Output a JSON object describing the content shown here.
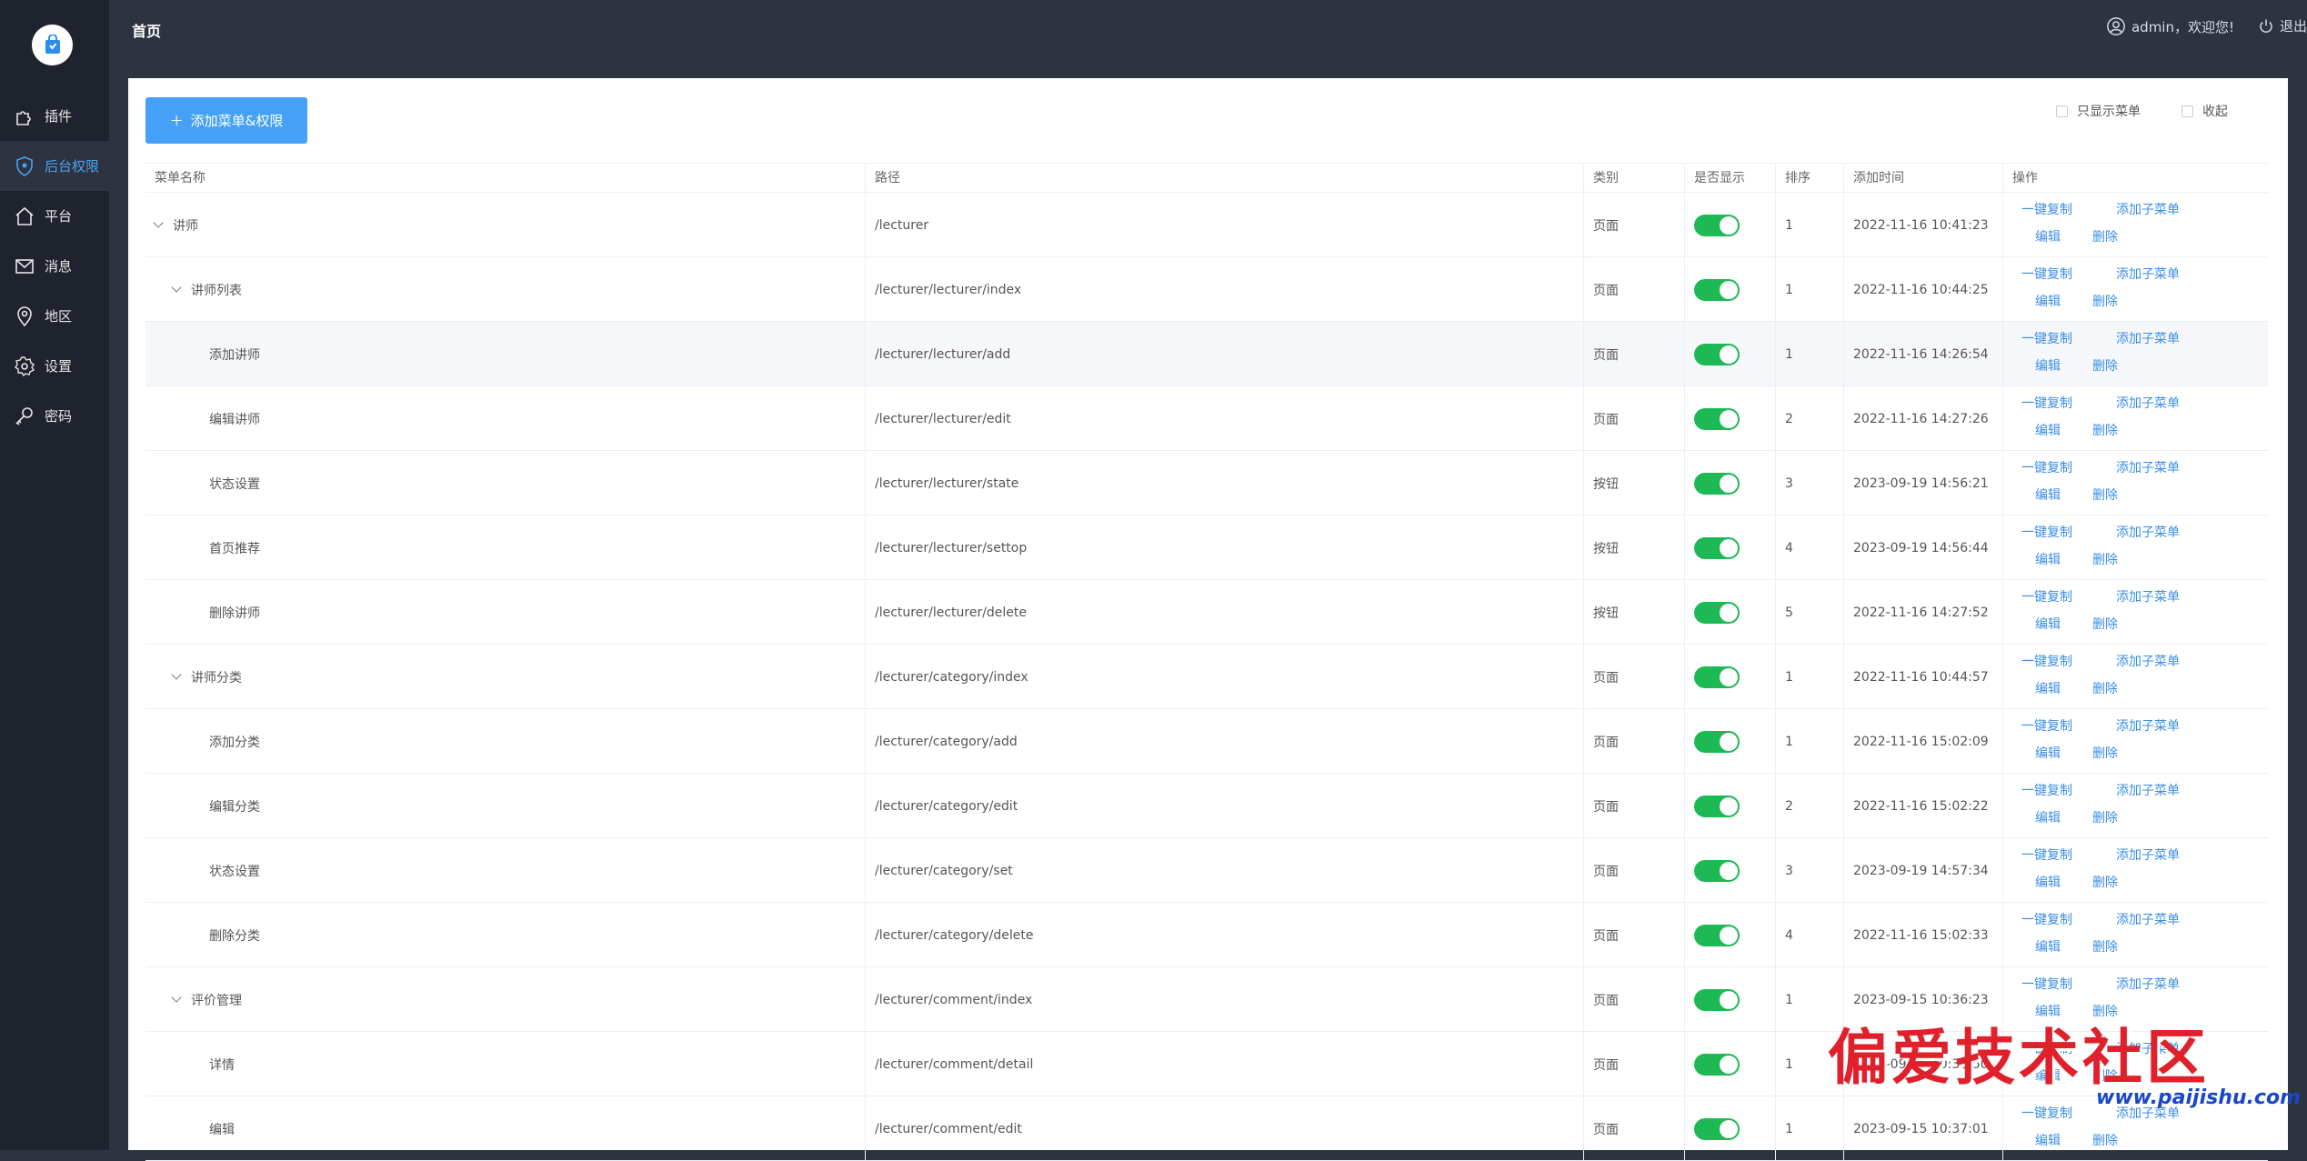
{
  "sidebar": {
    "items": [
      {
        "label": "插件",
        "icon": "puzzle-icon"
      },
      {
        "label": "后台权限",
        "icon": "shield-icon",
        "active": true
      },
      {
        "label": "平台",
        "icon": "home-icon"
      },
      {
        "label": "消息",
        "icon": "mail-icon"
      },
      {
        "label": "地区",
        "icon": "location-icon"
      },
      {
        "label": "设置",
        "icon": "gear-icon"
      },
      {
        "label": "密码",
        "icon": "key-icon"
      }
    ]
  },
  "header": {
    "title": "首页",
    "user": "admin，欢迎您!",
    "logout": "退出"
  },
  "toolbar": {
    "add_button": "添加菜单&权限",
    "only_menu": "只显示菜单",
    "collapse": "收起"
  },
  "table": {
    "columns": [
      "菜单名称",
      "路径",
      "类别",
      "是否显示",
      "排序",
      "添加时间",
      "操作"
    ],
    "ops": {
      "copy": "一键复制",
      "add_child": "添加子菜单",
      "edit": "编辑",
      "delete": "删除"
    },
    "rows": [
      {
        "name": "讲师",
        "path": "/lecturer",
        "type": "页面",
        "show": true,
        "sort": "1",
        "time": "2022-11-16 10:41:23",
        "level": 0,
        "expandable": true
      },
      {
        "name": "讲师列表",
        "path": "/lecturer/lecturer/index",
        "type": "页面",
        "show": true,
        "sort": "1",
        "time": "2022-11-16 10:44:25",
        "level": 1,
        "expandable": true
      },
      {
        "name": "添加讲师",
        "path": "/lecturer/lecturer/add",
        "type": "页面",
        "show": true,
        "sort": "1",
        "time": "2022-11-16 14:26:54",
        "level": 2,
        "expandable": false,
        "highlight": true
      },
      {
        "name": "编辑讲师",
        "path": "/lecturer/lecturer/edit",
        "type": "页面",
        "show": true,
        "sort": "2",
        "time": "2022-11-16 14:27:26",
        "level": 2,
        "expandable": false
      },
      {
        "name": "状态设置",
        "path": "/lecturer/lecturer/state",
        "type": "按钮",
        "show": true,
        "sort": "3",
        "time": "2023-09-19 14:56:21",
        "level": 2,
        "expandable": false
      },
      {
        "name": "首页推荐",
        "path": "/lecturer/lecturer/settop",
        "type": "按钮",
        "show": true,
        "sort": "4",
        "time": "2023-09-19 14:56:44",
        "level": 2,
        "expandable": false
      },
      {
        "name": "删除讲师",
        "path": "/lecturer/lecturer/delete",
        "type": "按钮",
        "show": true,
        "sort": "5",
        "time": "2022-11-16 14:27:52",
        "level": 2,
        "expandable": false
      },
      {
        "name": "讲师分类",
        "path": "/lecturer/category/index",
        "type": "页面",
        "show": true,
        "sort": "1",
        "time": "2022-11-16 10:44:57",
        "level": 1,
        "expandable": true
      },
      {
        "name": "添加分类",
        "path": "/lecturer/category/add",
        "type": "页面",
        "show": true,
        "sort": "1",
        "time": "2022-11-16 15:02:09",
        "level": 2,
        "expandable": false
      },
      {
        "name": "编辑分类",
        "path": "/lecturer/category/edit",
        "type": "页面",
        "show": true,
        "sort": "2",
        "time": "2022-11-16 15:02:22",
        "level": 2,
        "expandable": false
      },
      {
        "name": "状态设置",
        "path": "/lecturer/category/set",
        "type": "页面",
        "show": true,
        "sort": "3",
        "time": "2023-09-19 14:57:34",
        "level": 2,
        "expandable": false
      },
      {
        "name": "删除分类",
        "path": "/lecturer/category/delete",
        "type": "页面",
        "show": true,
        "sort": "4",
        "time": "2022-11-16 15:02:33",
        "level": 2,
        "expandable": false
      },
      {
        "name": "评价管理",
        "path": "/lecturer/comment/index",
        "type": "页面",
        "show": true,
        "sort": "1",
        "time": "2023-09-15 10:36:23",
        "level": 1,
        "expandable": true
      },
      {
        "name": "详情",
        "path": "/lecturer/comment/detail",
        "type": "页面",
        "show": true,
        "sort": "1",
        "time": "2023-09-15 10:36:50",
        "level": 2,
        "expandable": false
      },
      {
        "name": "编辑",
        "path": "/lecturer/comment/edit",
        "type": "页面",
        "show": true,
        "sort": "1",
        "time": "2023-09-15 10:37:01",
        "level": 2,
        "expandable": false
      }
    ]
  },
  "watermark": {
    "text": "偏爱技术社区",
    "url": "www.paijishu.com"
  },
  "colors": {
    "sidebar": "#1f232d",
    "topbar": "#2d3341",
    "accent": "#45a1f8",
    "switch_on": "#1db954",
    "link": "#3a8ee6"
  }
}
